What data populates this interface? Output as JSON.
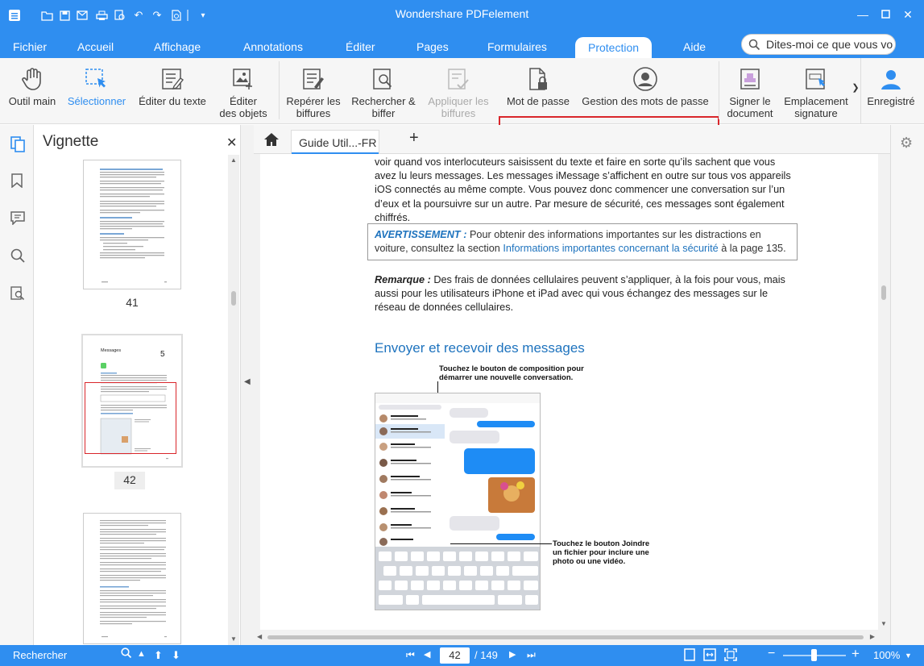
{
  "app": {
    "title": "Wondershare PDFelement"
  },
  "menu": {
    "tabs": [
      "Fichier",
      "Accueil",
      "Affichage",
      "Annotations",
      "Éditer",
      "Pages",
      "Formulaires",
      "Protection",
      "Aide"
    ],
    "active": "Protection",
    "search_placeholder": "Dites-moi ce que vous vo"
  },
  "ribbon": {
    "outil_main": "Outil main",
    "selectionner": "Sélectionner",
    "editer_texte": "Éditer du texte",
    "editer_objets_1": "Éditer",
    "editer_objets_2": "des objets",
    "reperer_1": "Repérer les",
    "reperer_2": "biffures",
    "rechercher_1": "Rechercher &",
    "rechercher_2": "biffer",
    "appliquer_1": "Appliquer les",
    "appliquer_2": "biffures",
    "mot_de_passe": "Mot de passe",
    "gestion": "Gestion des mots de passe",
    "signer_1": "Signer le",
    "signer_2": "document",
    "emplacement_1": "Emplacement",
    "emplacement_2": "signature",
    "enregistre": "Enregistré"
  },
  "thumbnails": {
    "title": "Vignette",
    "pages": [
      "41",
      "42"
    ]
  },
  "document": {
    "tab_label": "Guide Util...-FR",
    "para1": "voir quand vos interlocuteurs saisissent du texte et faire en sorte qu’ils sachent que vous avez lu leurs messages. Les messages iMessage s’affichent en outre sur tous vos appareils iOS connectés au même compte. Vous pouvez donc commencer une conversation sur l’un d’eux et la poursuivre sur un autre. Par mesure de sécurité, ces messages sont également chiffrés.",
    "warning_label": "AVERTISSEMENT :",
    "warning_text": " Pour obtenir des informations importantes sur les distractions en voiture, consultez la section ",
    "warning_link": "Informations importantes concernant la sécurité",
    "warning_end": " à la page 135.",
    "remark_label": "Remarque :",
    "remark_text": " Des frais de données cellulaires peuvent s’appliquer, à la fois pour vous, mais aussi pour les utilisateurs iPhone et iPad avec qui vous échangez des messages sur le réseau de données cellulaires.",
    "heading": "Envoyer et recevoir des messages",
    "callout1": "Touchez le bouton de composition pour démarrer une nouvelle conversation.",
    "callout2": "Touchez le bouton Joindre un fichier pour inclure une photo ou une vidéo."
  },
  "status": {
    "search_label": "Rechercher",
    "current_page": "42",
    "total_pages": "/ 149",
    "zoom": "100%"
  },
  "colors": {
    "accent": "#2f8ef0",
    "highlight_box": "#d9262b",
    "link": "#1e73be"
  }
}
